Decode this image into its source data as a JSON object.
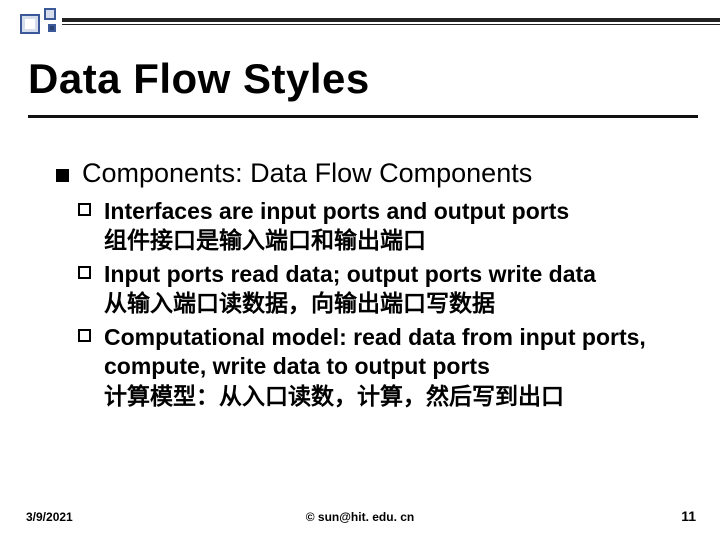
{
  "title": "Data Flow Styles",
  "bullets": [
    {
      "text": "Components: Data Flow Components",
      "children": [
        {
          "en": "Interfaces are input ports and output ports",
          "cn": "组件接口是输入端口和输出端口"
        },
        {
          "en": "Input ports read data; output ports write data",
          "cn": "从输入端口读数据，向输出端口写数据"
        },
        {
          "en": "Computational model: read data from input ports, compute, write data to output ports",
          "cn": "计算模型：从入口读数，计算，然后写到出口"
        }
      ]
    }
  ],
  "footer": {
    "date": "3/9/2021",
    "copyright": "© sun@hit. edu. cn",
    "page": "11"
  }
}
